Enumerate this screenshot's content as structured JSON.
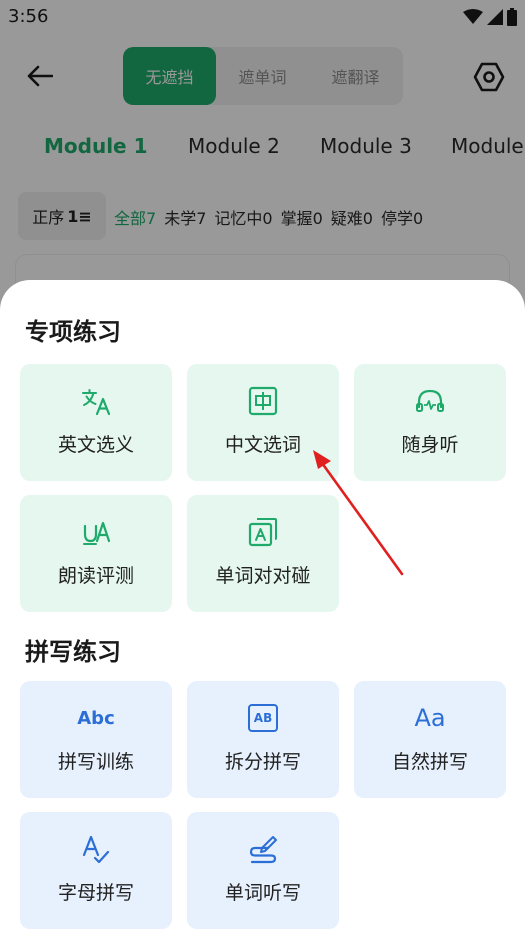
{
  "status_bar": {
    "time": "3:56"
  },
  "header": {
    "segments": [
      {
        "label": "无遮挡",
        "active": true
      },
      {
        "label": "遮单词",
        "active": false
      },
      {
        "label": "遮翻译",
        "active": false
      }
    ]
  },
  "module_tabs": [
    {
      "label": "Module 1",
      "active": true
    },
    {
      "label": "Module 2",
      "active": false
    },
    {
      "label": "Module 3",
      "active": false
    },
    {
      "label": "Module",
      "active": false
    }
  ],
  "filters": {
    "sort_label": "正序",
    "sort_icon": "1≡",
    "items": [
      "全部7",
      "未学7",
      "记忆中0",
      "掌握0",
      "疑难0",
      "停学0"
    ]
  },
  "sheet": {
    "special_title": "专项练习",
    "special_items": [
      {
        "label": "英文选义",
        "icon": "translate-icon"
      },
      {
        "label": "中文选词",
        "icon": "zhong-box-icon"
      },
      {
        "label": "随身听",
        "icon": "headphones-icon"
      },
      {
        "label": "朗读评测",
        "icon": "speech-eval-icon"
      },
      {
        "label": "单词对对碰",
        "icon": "stacked-cards-icon"
      }
    ],
    "spelling_title": "拼写练习",
    "spelling_items": [
      {
        "label": "拼写训练",
        "icon": "abc-icon",
        "icon_text": "Abc"
      },
      {
        "label": "拆分拼写",
        "icon": "ab-box-icon",
        "icon_text": "AB"
      },
      {
        "label": "自然拼写",
        "icon": "aa-icon",
        "icon_text": "Aa"
      },
      {
        "label": "字母拼写",
        "icon": "a-check-icon"
      },
      {
        "label": "单词听写",
        "icon": "pen-dictation-icon"
      }
    ]
  },
  "colors": {
    "accent_green": "#1faa6b",
    "accent_blue": "#2b6fd6",
    "annotation_red": "#e02020"
  }
}
